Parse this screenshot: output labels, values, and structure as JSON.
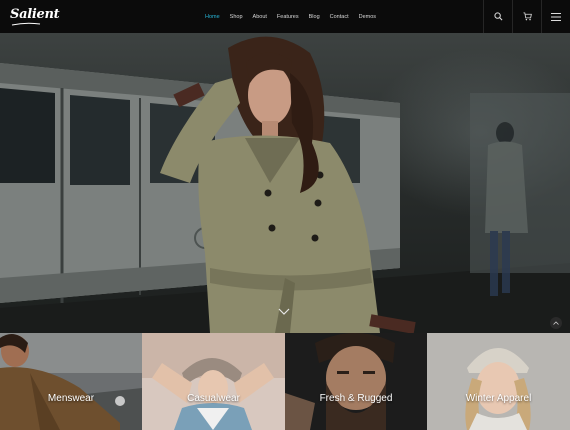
{
  "brand": {
    "logo_text": "Salient"
  },
  "nav": {
    "items": [
      {
        "label": "Home",
        "active": true
      },
      {
        "label": "Shop",
        "active": false
      },
      {
        "label": "About",
        "active": false
      },
      {
        "label": "Features",
        "active": false
      },
      {
        "label": "Blog",
        "active": false
      },
      {
        "label": "Contact",
        "active": false
      },
      {
        "label": "Demos",
        "active": false
      }
    ],
    "icons": [
      "search-icon",
      "cart-icon",
      "hamburger-menu-icon"
    ]
  },
  "hero": {
    "scroll_down_icon": "chevron-down-icon",
    "back_to_top_icon": "chevron-up-icon"
  },
  "categories": [
    {
      "label": "Menswear"
    },
    {
      "label": "Casualwear"
    },
    {
      "label": "Fresh & Rugged"
    },
    {
      "label": "Winter Apparel"
    }
  ],
  "colors": {
    "accent": "#27b4d6",
    "nav_background": "#0b0b0b",
    "nav_text": "#d9d9d9",
    "coat": "#8c8a6b"
  }
}
